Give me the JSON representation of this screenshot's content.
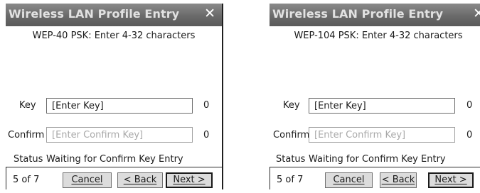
{
  "dialogs": [
    {
      "title": "Wireless LAN Profile Entry",
      "close_icon": "close-icon",
      "header": "WEP-40 PSK: Enter 4-32 characters",
      "key_label": "Key",
      "key_value": "[Enter Key]",
      "key_count": "0",
      "confirm_label": "Confirm",
      "confirm_placeholder": "[Enter Confirm Key]",
      "confirm_count": "0",
      "status_label": "Status",
      "status_value": "Waiting for Confirm Key Entry",
      "page": "5 of 7",
      "cancel_label": "Cancel",
      "back_label": "< Back",
      "next_label": "Next >"
    },
    {
      "title": "Wireless LAN Profile Entry",
      "close_icon": "close-icon",
      "header": "WEP-104 PSK: Enter 4-32 characters",
      "key_label": "Key",
      "key_value": "[Enter Key]",
      "key_count": "0",
      "confirm_label": "Confirm",
      "confirm_placeholder": "[Enter Confirm Key]",
      "confirm_count": "0",
      "status_label": "Status",
      "status_value": "Waiting for Confirm Key Entry",
      "page": "5 of 7",
      "cancel_label": "Cancel",
      "back_label": "< Back",
      "next_label": "Next >"
    }
  ],
  "colors": {
    "titlebar": "#6a6a6a",
    "title_text": "#e2e2e2",
    "button_face": "#dcdcdc",
    "placeholder": "#a9a9a9"
  }
}
